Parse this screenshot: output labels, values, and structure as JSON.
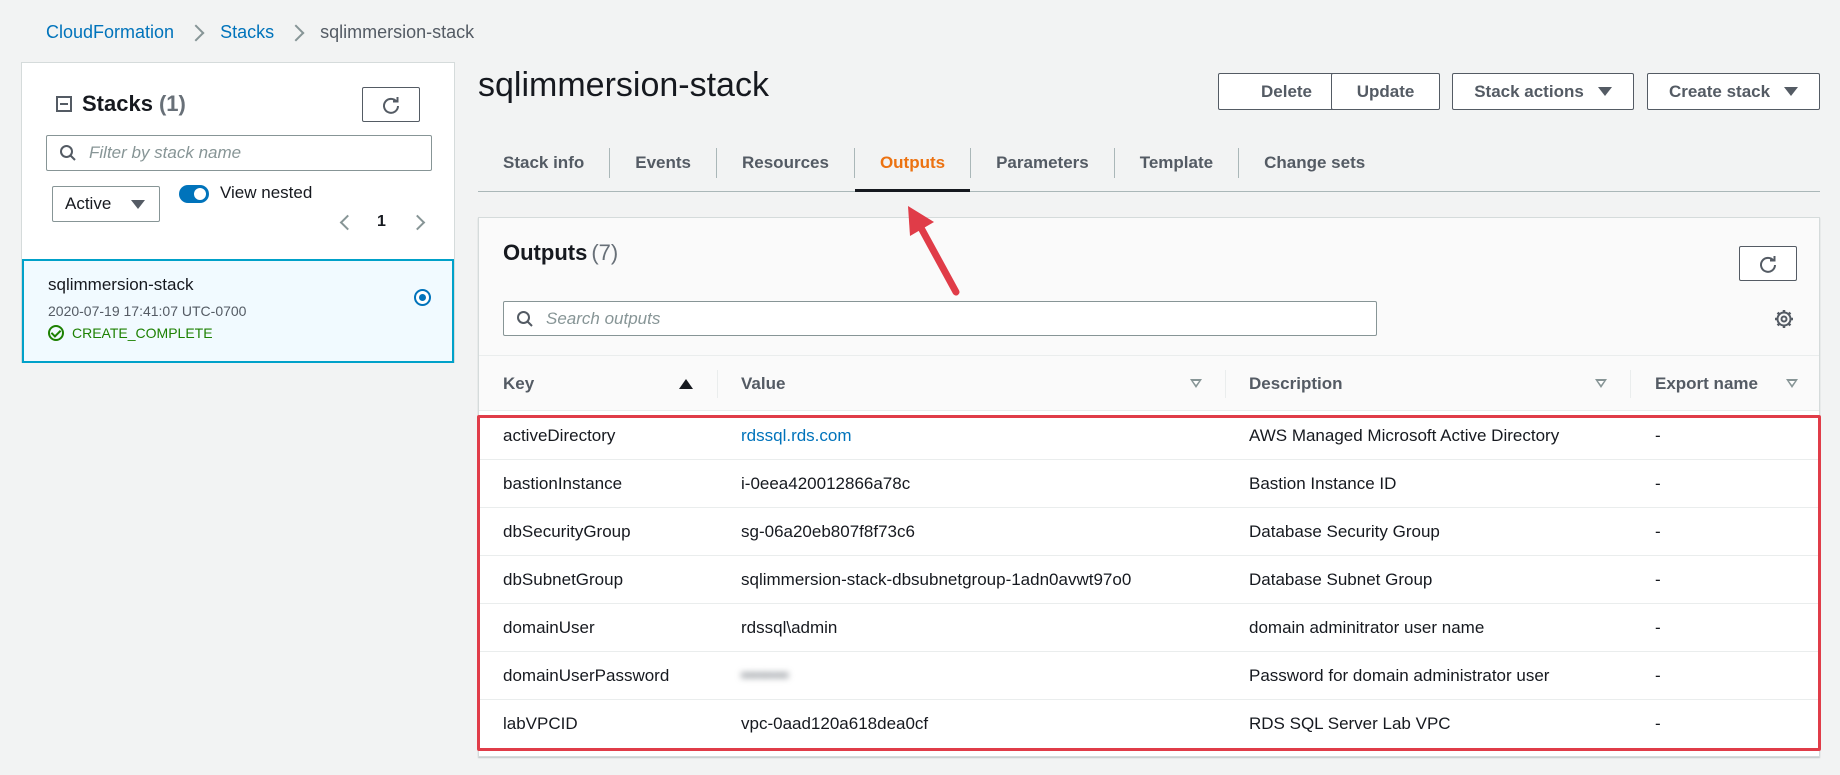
{
  "breadcrumb": {
    "items": [
      "CloudFormation",
      "Stacks"
    ],
    "current": "sqlimmersion-stack"
  },
  "sidebar": {
    "title": "Stacks",
    "count": "(1)",
    "filter_placeholder": "Filter by stack name",
    "status_filter": "Active",
    "view_nested_label": "View nested",
    "view_nested_enabled": true,
    "page": "1",
    "stacks": [
      {
        "name": "sqlimmersion-stack",
        "date": "2020-07-19 17:41:07 UTC-0700",
        "status": "CREATE_COMPLETE"
      }
    ]
  },
  "header": {
    "title": "sqlimmersion-stack",
    "buttons": {
      "delete": "Delete",
      "update": "Update",
      "stack_actions": "Stack actions",
      "create_stack": "Create stack"
    }
  },
  "tabs": [
    {
      "label": "Stack info",
      "active": false
    },
    {
      "label": "Events",
      "active": false
    },
    {
      "label": "Resources",
      "active": false
    },
    {
      "label": "Outputs",
      "active": true
    },
    {
      "label": "Parameters",
      "active": false
    },
    {
      "label": "Template",
      "active": false
    },
    {
      "label": "Change sets",
      "active": false
    }
  ],
  "outputs": {
    "title": "Outputs",
    "count": "(7)",
    "search_placeholder": "Search outputs",
    "columns": {
      "key": "Key",
      "value": "Value",
      "description": "Description",
      "export_name": "Export name"
    },
    "rows": [
      {
        "key": "activeDirectory",
        "value": "rdssql.rds.com",
        "description": "AWS Managed Microsoft Active Directory",
        "export": "-"
      },
      {
        "key": "bastionInstance",
        "value": "i-0eea420012866a78c",
        "description": "Bastion Instance ID",
        "export": "-"
      },
      {
        "key": "dbSecurityGroup",
        "value": "sg-06a20eb807f8f73c6",
        "description": "Database Security Group",
        "export": "-"
      },
      {
        "key": "dbSubnetGroup",
        "value": "sqlimmersion-stack-dbsubnetgroup-1adn0avwt97o0",
        "description": "Database Subnet Group",
        "export": "-"
      },
      {
        "key": "domainUser",
        "value": "rdssql\\admin",
        "description": "domain adminitrator user name",
        "export": "-"
      },
      {
        "key": "domainUserPassword",
        "value": "••••••••",
        "description": "Password for domain administrator user",
        "export": "-"
      },
      {
        "key": "labVPCID",
        "value": "vpc-0aad120a618dea0cf",
        "description": "RDS SQL Server Lab VPC",
        "export": "-"
      }
    ]
  },
  "colors": {
    "link": "#0073bb",
    "active_tab": "#ec7211",
    "success": "#1d8102",
    "annotation": "#e03c48"
  }
}
